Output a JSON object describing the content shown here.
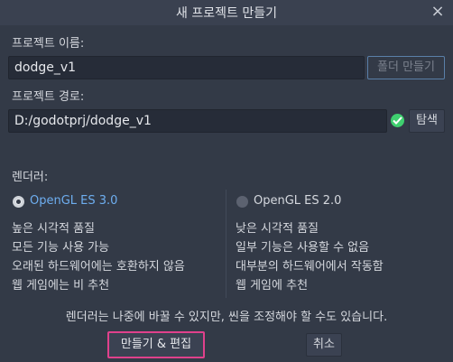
{
  "dialog": {
    "title": "새 프로젝트 만들기",
    "close_glyph": "×"
  },
  "project_name": {
    "label": "프로젝트 이름:",
    "value": "dodge_v1",
    "create_folder_button": "폴더 만들기"
  },
  "project_path": {
    "label": "프로젝트 경로:",
    "value": "D:/godotprj/dodge_v1",
    "valid_icon": "check-circle-icon",
    "browse_button": "탐색"
  },
  "renderer": {
    "label": "렌더러:",
    "options": [
      {
        "name": "OpenGL ES 3.0",
        "selected": true,
        "lines": [
          "높은 시각적 품질",
          "모든 기능 사용 가능",
          "오래된 하드웨어에는 호환하지 않음",
          "웹 게임에는 비 추천"
        ]
      },
      {
        "name": "OpenGL ES 2.0",
        "selected": false,
        "lines": [
          "낮은 시각적 품질",
          "일부 기능은 사용할 수 없음",
          "대부분의 하드웨어에서 작동함",
          "웹 게임에 추천"
        ]
      }
    ],
    "note": "렌더러는 나중에 바꿀 수 있지만, 씬을 조정해야 할 수도 있습니다."
  },
  "actions": {
    "create_edit": "만들기 & 편집",
    "cancel": "취소"
  },
  "colors": {
    "background": "#333a47",
    "accent": "#6eaef0",
    "valid": "#3fcf6f",
    "focus": "#e0418c"
  }
}
